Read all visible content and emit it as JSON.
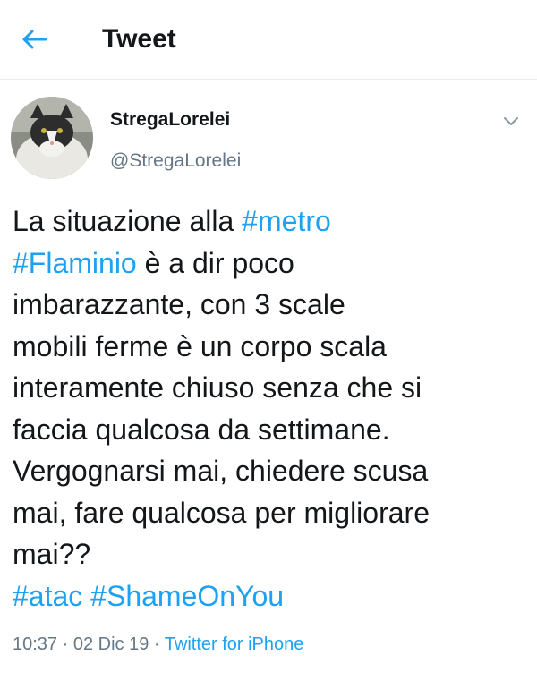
{
  "header": {
    "title": "Tweet",
    "back_icon": "arrow-left-icon"
  },
  "author": {
    "display_name": "StregaLorelei",
    "handle": "@StregaLorelei",
    "avatar": "cat-avatar"
  },
  "tweet": {
    "lines": [
      [
        "La situazione alla ",
        {
          "hashtag": "#metro"
        }
      ],
      [
        {
          "hashtag": "#Flaminio"
        },
        " è a dir poco"
      ],
      [
        "imbarazzante, con 3 scale"
      ],
      [
        "mobili ferme è un corpo scala"
      ],
      [
        "interamente chiuso senza che si"
      ],
      [
        "faccia qualcosa da settimane."
      ],
      [
        "Vergognarsi mai, chiedere scusa"
      ],
      [
        "mai, fare qualcosa per migliorare"
      ],
      [
        "mai??"
      ],
      [
        {
          "hashtag": "#atac"
        },
        " ",
        {
          "hashtag": "#ShameOnYou"
        }
      ]
    ]
  },
  "meta": {
    "time": "10:37",
    "separator": " · ",
    "date": "02 Dic 19",
    "source": "Twitter for iPhone"
  },
  "colors": {
    "accent": "#1da1f2",
    "secondary_text": "#657786",
    "primary_text": "#14171a"
  },
  "icons": {
    "more": "chevron-down-icon"
  }
}
